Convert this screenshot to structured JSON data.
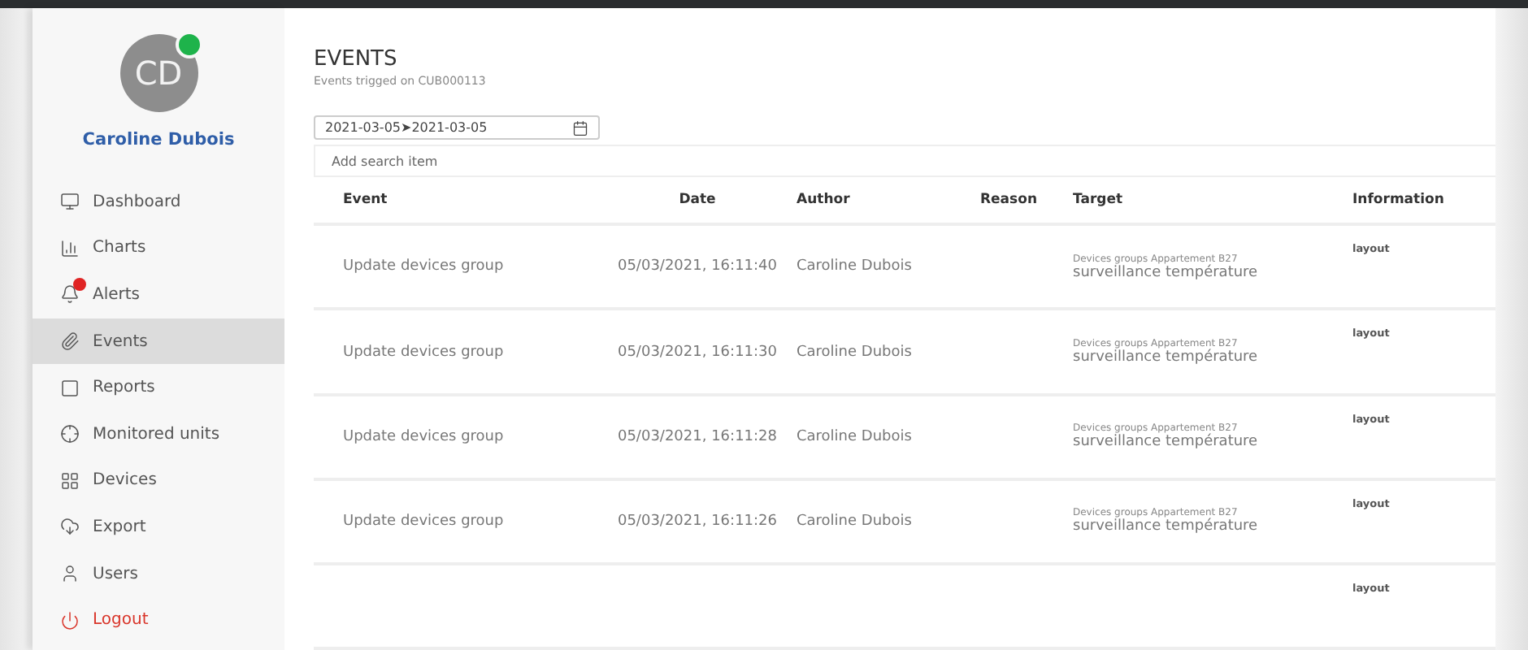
{
  "user": {
    "initials": "CD",
    "name": "Caroline Dubois",
    "online": true
  },
  "sidebar": {
    "items": [
      {
        "kind": "dashboard",
        "label": "Dashboard",
        "selected": false
      },
      {
        "kind": "charts",
        "label": "Charts",
        "selected": false
      },
      {
        "kind": "alerts",
        "label": "Alerts",
        "selected": false,
        "badge": true
      },
      {
        "kind": "events",
        "label": "Events",
        "selected": true
      },
      {
        "kind": "reports",
        "label": "Reports",
        "selected": false
      },
      {
        "kind": "units",
        "label": "Monitored units",
        "selected": false
      },
      {
        "kind": "devices",
        "label": "Devices",
        "selected": false
      },
      {
        "kind": "export",
        "label": "Export",
        "selected": false
      },
      {
        "kind": "users",
        "label": "Users",
        "selected": false
      },
      {
        "kind": "logout",
        "label": "Logout",
        "selected": false
      }
    ]
  },
  "page": {
    "title": "EVENTS",
    "subtitle": "Events trigged on CUB000113"
  },
  "date_range": {
    "value": "2021-03-05➤2021-03-05"
  },
  "search": {
    "placeholder": "Add search item"
  },
  "table": {
    "columns": [
      "Event",
      "Date",
      "Author",
      "Reason",
      "Target",
      "Information"
    ],
    "rows": [
      {
        "event": "Update devices group",
        "date": "05/03/2021, 16:11:40",
        "author": "Caroline Dubois",
        "target_type": "Devices groups Appartement B27",
        "target": "surveillance température",
        "information": "layout"
      },
      {
        "event": "Update devices group",
        "date": "05/03/2021, 16:11:30",
        "author": "Caroline Dubois",
        "target_type": "Devices groups Appartement B27",
        "target": "surveillance température",
        "information": "layout"
      },
      {
        "event": "Update devices group",
        "date": "05/03/2021, 16:11:28",
        "author": "Caroline Dubois",
        "target_type": "Devices groups Appartement B27",
        "target": "surveillance température",
        "information": "layout"
      },
      {
        "event": "Update devices group",
        "date": "05/03/2021, 16:11:26",
        "author": "Caroline Dubois",
        "target_type": "Devices groups Appartement B27",
        "target": "surveillance température",
        "information": "layout"
      },
      {
        "information": "layout"
      }
    ]
  }
}
